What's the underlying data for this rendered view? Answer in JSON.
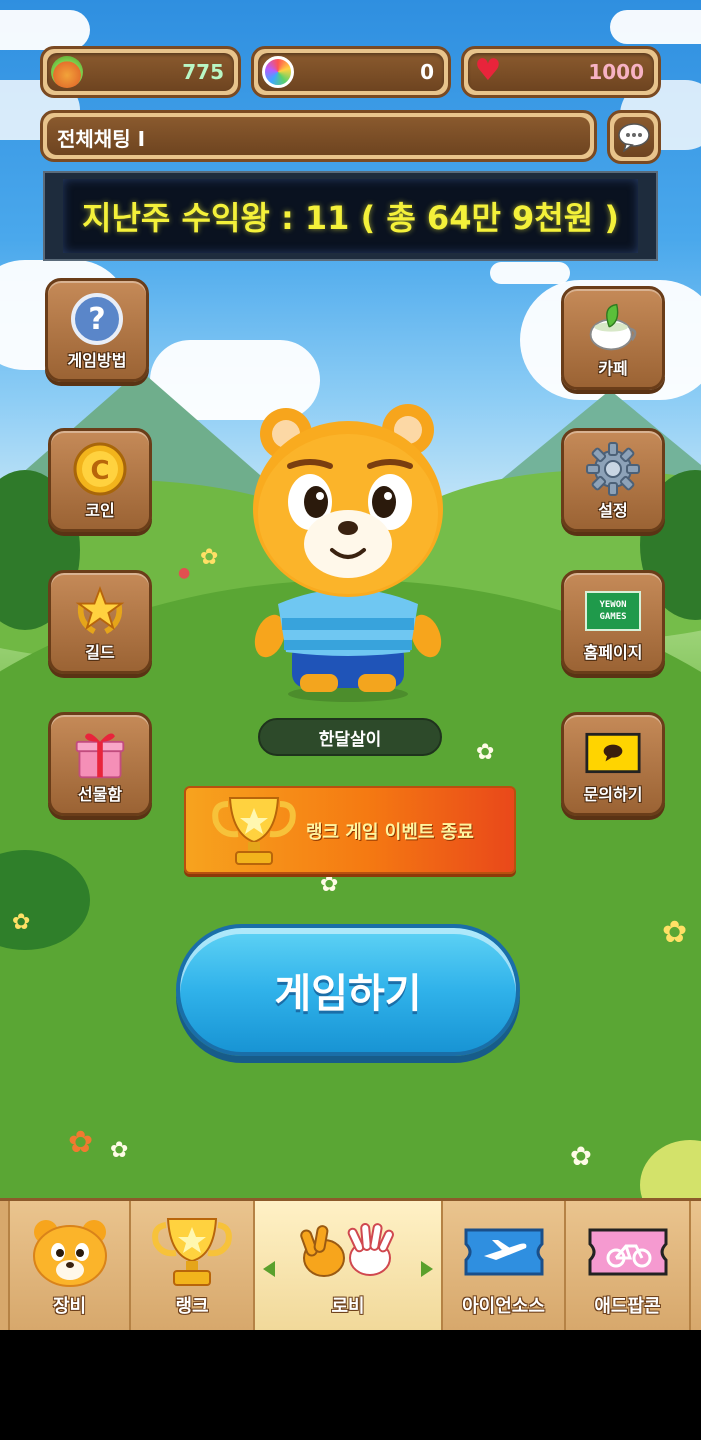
{
  "resources": {
    "food": {
      "value": "775",
      "color": "#b9f7c5"
    },
    "gem": {
      "value": "0",
      "color": "#ffffff"
    },
    "heart": {
      "value": "1000",
      "color": "#f7b2c4"
    }
  },
  "chat": {
    "text": "전체채팅 I"
  },
  "ticker": {
    "text": "지난주 수익왕 : 11 ( 총 64만 9천원 )"
  },
  "side_left": [
    {
      "label": "게임방법",
      "icon": "help-icon"
    },
    {
      "label": "코인",
      "icon": "coin-icon"
    },
    {
      "label": "길드",
      "icon": "guild-star-icon"
    },
    {
      "label": "선물함",
      "icon": "gift-box-icon"
    }
  ],
  "side_right": [
    {
      "label": "카페",
      "icon": "cafe-cup-icon"
    },
    {
      "label": "설정",
      "icon": "gear-icon"
    },
    {
      "label": "홈페이지",
      "icon": "yewon-games-logo"
    },
    {
      "label": "문의하기",
      "icon": "speech-bubble-icon"
    }
  ],
  "yewon_logo": "YEWON GAMES",
  "character": {
    "name": "한달살이"
  },
  "event": {
    "text": "랭크 게임 이벤트 종료"
  },
  "play": {
    "label": "게임하기"
  },
  "nav": [
    {
      "label": "장비",
      "icon": "bear-face-icon",
      "active": false
    },
    {
      "label": "랭크",
      "icon": "trophy-icon",
      "active": false
    },
    {
      "label": "로비",
      "icon": "hand-sign-icon",
      "active": true
    },
    {
      "label": "아이언소스",
      "icon": "plane-ticket-icon",
      "active": false
    },
    {
      "label": "애드팝콘",
      "icon": "bicycle-ticket-icon",
      "active": false
    }
  ]
}
